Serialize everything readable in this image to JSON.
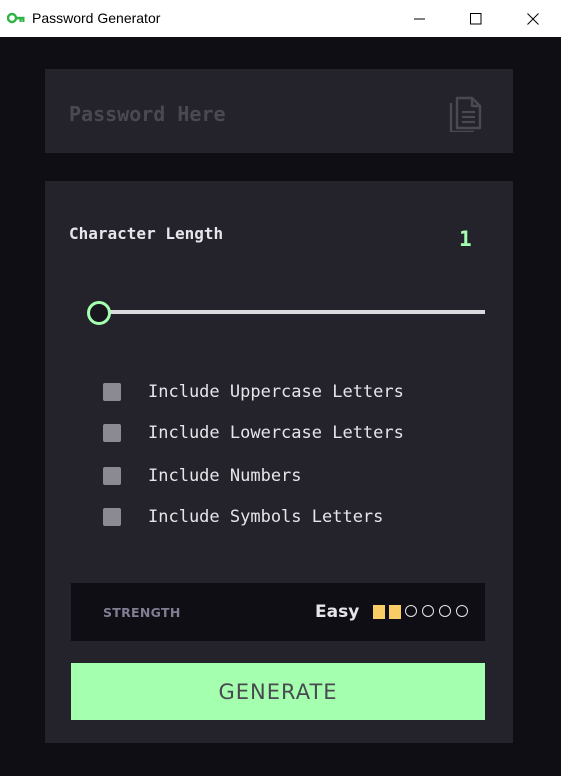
{
  "window": {
    "title": "Password Generator",
    "app_icon": "key-icon",
    "controls": [
      "minimize-icon",
      "maximize-icon",
      "close-icon"
    ]
  },
  "password": {
    "value": "",
    "placeholder": "Password Here",
    "copy_icon": "copy-icon"
  },
  "length": {
    "label": "Character Length",
    "value": "1",
    "slider_level": 0.0
  },
  "options": [
    {
      "label": "Include Uppercase Letters",
      "checked": false
    },
    {
      "label": "Include Lowercase Letters",
      "checked": false
    },
    {
      "label": "Include Numbers",
      "checked": false
    },
    {
      "label": "Include Symbols Letters",
      "checked": false
    }
  ],
  "strength": {
    "label": "STRENGTH",
    "level": "Easy",
    "bars_filled": 2,
    "bars_total": 6
  },
  "generate": {
    "label": "GENERATE"
  },
  "colors": {
    "background": "#0f0e14",
    "card": "#24232c",
    "accent": "#a4ffaf",
    "strength_fill": "#f8cd65",
    "text": "#e6e5ea"
  }
}
